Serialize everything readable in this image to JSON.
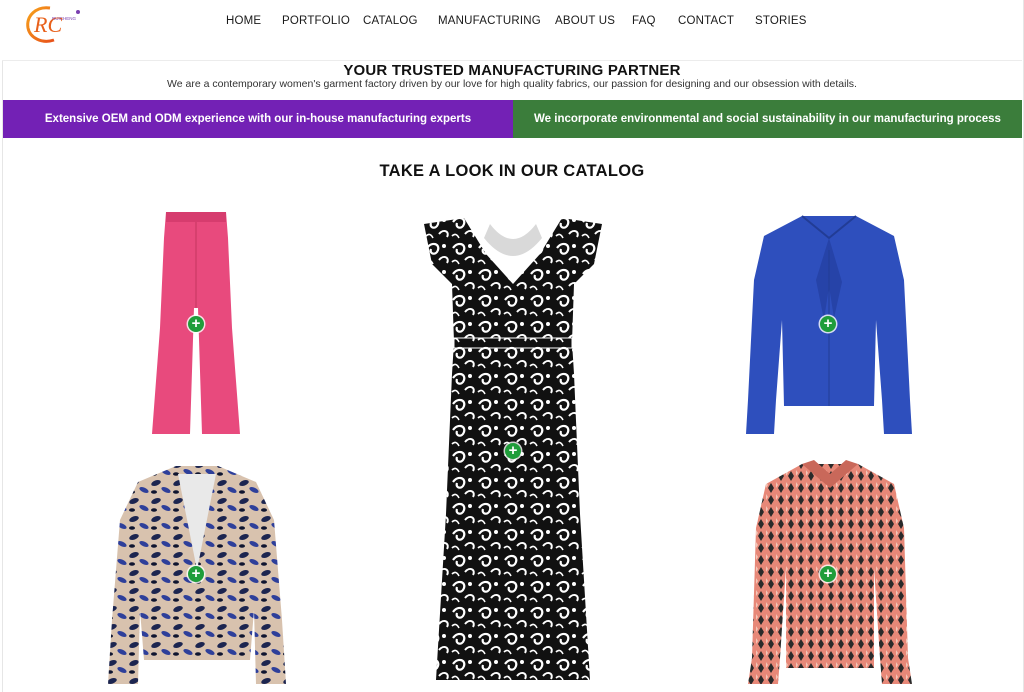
{
  "logo": {
    "letters": "RC",
    "small_text": "RUICHENG"
  },
  "nav": [
    {
      "label": "HOME"
    },
    {
      "label": "PORTFOLIO"
    },
    {
      "label": "CATALOG"
    },
    {
      "label": "MANUFACTURING"
    },
    {
      "label": "ABOUT US"
    },
    {
      "label": "FAQ"
    },
    {
      "label": "CONTACT"
    },
    {
      "label": "STORIES"
    }
  ],
  "intro": {
    "headline": "YOUR TRUSTED MANUFACTURING PARTNER",
    "tagline": "We are a contemporary women's garment factory driven by our love for high quality fabrics, our passion for designing and our obsession with details."
  },
  "banners": {
    "left": "Extensive OEM and ODM experience with our in-house manufacturing experts",
    "right": "We incorporate environmental and social sustainability in our manufacturing process"
  },
  "catalog": {
    "title": "TAKE A LOOK IN OUR CATALOG",
    "products": [
      {
        "icon": "pink-flared-trousers",
        "color": "#e84a7d"
      },
      {
        "icon": "black-white-printed-ruffle-dress",
        "color": "#111111"
      },
      {
        "icon": "blue-bow-blouse",
        "color": "#2e4fbd"
      },
      {
        "icon": "animal-print-blazer",
        "color": "#2a3a7a"
      },
      {
        "icon": "coral-print-shirt",
        "color": "#e07f6f"
      }
    ],
    "plus_symbol": "+"
  },
  "colors": {
    "purple_banner": "#7321b5",
    "green_banner": "#3b7d3b",
    "plus_button": "#1f9d3a"
  }
}
